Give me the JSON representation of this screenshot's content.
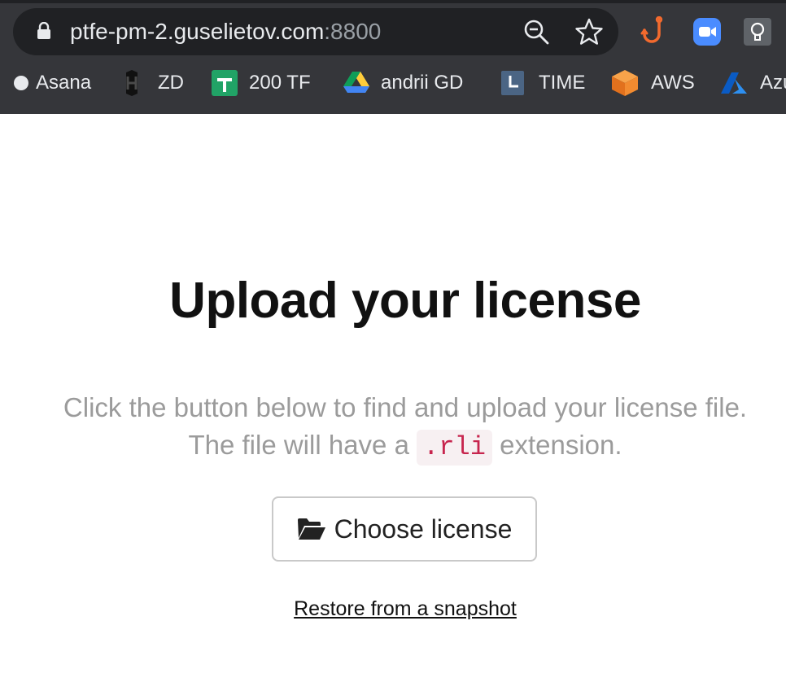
{
  "browser": {
    "url_host": "ptfe-pm-2.guselietov.com",
    "url_port": ":8800",
    "bookmarks": [
      {
        "label": "Asana",
        "icon": "circle-icon"
      },
      {
        "label": "ZD",
        "icon": "hashicorp-icon"
      },
      {
        "label": "200 TF",
        "icon": "sheets-icon"
      },
      {
        "label": "andrii  GD",
        "icon": "drive-icon"
      },
      {
        "label": "TIME",
        "icon": "clock-icon"
      },
      {
        "label": "AWS",
        "icon": "aws-box-icon"
      },
      {
        "label": "Azu",
        "icon": "azure-icon"
      }
    ]
  },
  "main": {
    "title": "Upload your license",
    "desc_line1": "Click the button below to find and upload your license file.",
    "desc_line2_pre": "The file will have a ",
    "desc_code": ".rli",
    "desc_line2_post": " extension.",
    "choose_button": "Choose license",
    "restore_link": "Restore from a snapshot"
  },
  "colors": {
    "chrome_bg": "#35363a",
    "omnibox_bg": "#202124",
    "code_text": "#c7254e",
    "desc_text": "#9b9b9b"
  }
}
